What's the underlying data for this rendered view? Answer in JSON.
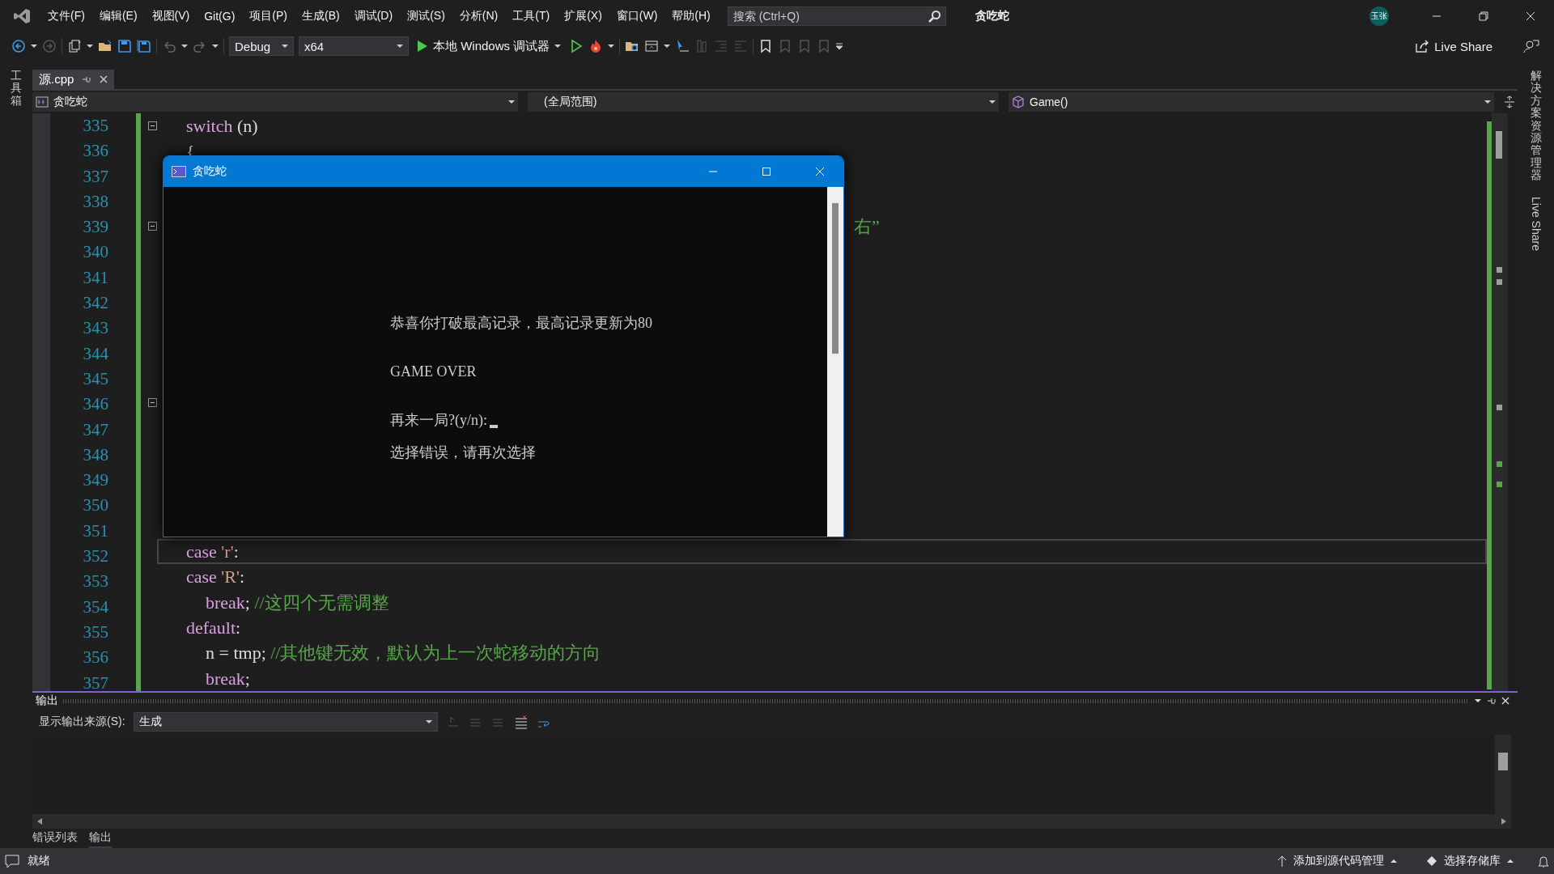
{
  "window": {
    "title": "贪吃蛇",
    "search_placeholder": "搜索 (Ctrl+Q)",
    "account": "玉张"
  },
  "menu": [
    "文件(F)",
    "编辑(E)",
    "视图(V)",
    "Git(G)",
    "项目(P)",
    "生成(B)",
    "调试(D)",
    "测试(S)",
    "分析(N)",
    "工具(T)",
    "扩展(X)",
    "窗口(W)",
    "帮助(H)"
  ],
  "toolbar": {
    "configuration": "Debug",
    "platform": "x64",
    "debugger": "本地 Windows 调试器",
    "live_share": "Live Share"
  },
  "left_strip": [
    "工具箱"
  ],
  "right_strip": [
    {
      "label": "解决方案资源管理器",
      "kind": "cjk"
    },
    {
      "label": "Live Share",
      "kind": "latin"
    }
  ],
  "tabs": [
    {
      "label": "源.cpp",
      "selected": true
    }
  ],
  "nav_bar": {
    "project": "贪吃蛇",
    "scope": "(全局范围)",
    "member": "Game()"
  },
  "editor": {
    "lines": [
      {
        "number": "335",
        "fold": true,
        "current": false,
        "tokens": [
          {
            "kind": "keyword",
            "text": "switch"
          },
          {
            "kind": "plain",
            "text": " (n)"
          }
        ]
      },
      {
        "number": "336",
        "fold": false,
        "current": false,
        "tokens": [
          {
            "kind": "plain",
            "text": "{"
          }
        ]
      },
      {
        "number": "337",
        "fold": false,
        "current": false
      },
      {
        "number": "338",
        "fold": false,
        "current": false
      },
      {
        "number": "339",
        "fold": true,
        "current": false,
        "clipped": true,
        "tokens": [
          {
            "kind": "comment",
            "text": "右”"
          }
        ]
      },
      {
        "number": "340",
        "fold": false,
        "current": false
      },
      {
        "number": "341",
        "fold": false,
        "current": false
      },
      {
        "number": "342",
        "fold": false,
        "current": false
      },
      {
        "number": "343",
        "fold": false,
        "current": false
      },
      {
        "number": "344",
        "fold": false,
        "current": false
      },
      {
        "number": "345",
        "fold": false,
        "current": false
      },
      {
        "number": "346",
        "fold": true,
        "current": false
      },
      {
        "number": "347",
        "fold": false,
        "current": false
      },
      {
        "number": "348",
        "fold": false,
        "current": false
      },
      {
        "number": "349",
        "fold": false,
        "current": false
      },
      {
        "number": "350",
        "fold": false,
        "current": false
      },
      {
        "number": "351",
        "fold": false,
        "current": false
      },
      {
        "number": "352",
        "fold": false,
        "current": true,
        "tokens": [
          {
            "kind": "keyword",
            "text": "case "
          },
          {
            "kind": "string",
            "text": "'r'"
          },
          {
            "kind": "plain",
            "text": ":"
          }
        ]
      },
      {
        "number": "353",
        "fold": false,
        "current": false,
        "tokens": [
          {
            "kind": "keyword",
            "text": "case "
          },
          {
            "kind": "string",
            "text": "'R'"
          },
          {
            "kind": "plain",
            "text": ":"
          }
        ],
        "children": [
          {
            "number": "354",
            "fold": false,
            "current": false,
            "tokens": [
              {
                "kind": "keyword",
                "text": "break"
              },
              {
                "kind": "plain",
                "text": "; "
              },
              {
                "kind": "comment",
                "text": "//这四个无需调整"
              }
            ]
          }
        ]
      },
      {
        "number": "355",
        "fold": false,
        "current": false,
        "tokens": [
          {
            "kind": "keyword",
            "text": "default"
          },
          {
            "kind": "plain",
            "text": ":"
          }
        ],
        "children": [
          {
            "number": "356",
            "fold": false,
            "current": false,
            "tokens": [
              {
                "kind": "plain",
                "text": "n = tmp; "
              },
              {
                "kind": "comment",
                "text": "//其他键无效，默认为上一次蛇移动的方向"
              }
            ]
          },
          {
            "number": "357",
            "fold": false,
            "current": false,
            "tokens": [
              {
                "kind": "keyword",
                "text": "break"
              },
              {
                "kind": "plain",
                "text": ";"
              }
            ]
          }
        ]
      }
    ]
  },
  "console": {
    "title": "贪吃蛇",
    "lines": [
      {
        "text": "恭喜你打破最高记录，最高记录更新为80",
        "cursor": false
      },
      {
        "text": "GAME OVER",
        "cursor": false
      },
      {
        "text": "再来一局?(y/n):",
        "cursor": true
      },
      {
        "text": "选择错误，请再次选择",
        "cursor": false
      }
    ]
  },
  "output": {
    "title": "输出",
    "source_label": "显示输出来源(S):",
    "source": "生成"
  },
  "bottom_tabs": [
    {
      "label": "错误列表",
      "selected": false
    },
    {
      "label": "输出",
      "selected": true
    }
  ],
  "status_bar": {
    "text": "就绪",
    "source_control": "添加到源代码管理",
    "repository": "选择存储库"
  }
}
